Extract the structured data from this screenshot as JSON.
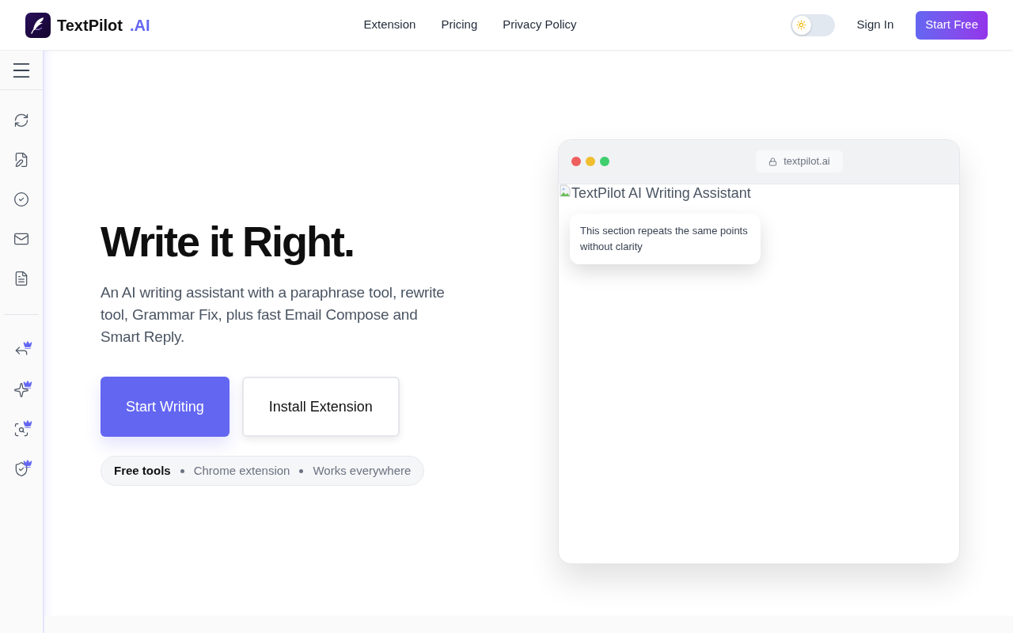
{
  "header": {
    "logo": {
      "name": "TextPilot",
      "suffix": ".AI"
    },
    "nav": [
      "Extension",
      "Pricing",
      "Privacy Policy"
    ],
    "theme_toggle": {
      "on": false
    },
    "sign_in": "Sign In",
    "start_free": "Start Free"
  },
  "sidebar": {
    "groups": [
      {
        "items": [
          {
            "premium": false
          },
          {
            "premium": false
          },
          {
            "premium": false
          },
          {
            "premium": false
          },
          {
            "premium": false
          }
        ]
      },
      {
        "items": [
          {
            "premium": true
          },
          {
            "premium": true
          },
          {
            "premium": true
          },
          {
            "premium": true
          }
        ]
      }
    ]
  },
  "hero": {
    "title": "Write it Right.",
    "description": "An AI writing assistant with a paraphrase tool, rewrite tool, Grammar Fix, plus fast Email Compose and Smart Reply.",
    "buttons": [
      {
        "label": "Start Writing",
        "kind": "primary"
      },
      {
        "label": "Install Extension",
        "kind": "secondary"
      }
    ],
    "features": [
      {
        "label": "Free tools",
        "highlighted": true
      },
      {
        "label": "Chrome extension",
        "highlighted": false
      },
      {
        "label": "Works everywhere",
        "highlighted": false
      }
    ]
  },
  "preview": {
    "url": "textpilot.ai",
    "image_alt": "TextPilot AI Writing Assistant",
    "comment": "This section repeats the same points without clarity"
  }
}
